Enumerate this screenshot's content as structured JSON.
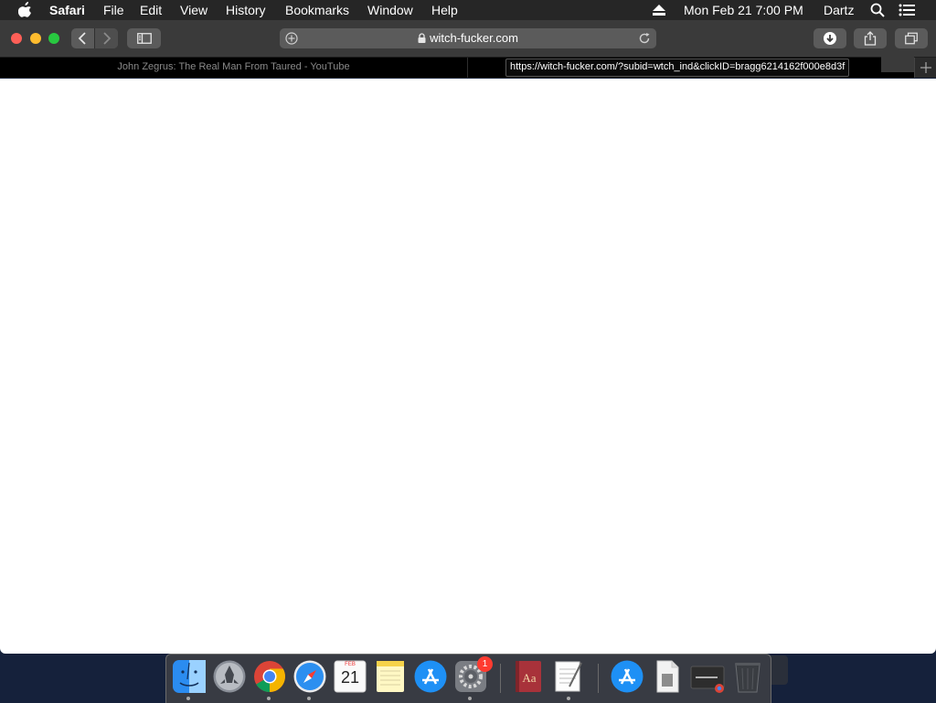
{
  "menubar": {
    "app_name": "Safari",
    "items": [
      "File",
      "Edit",
      "View",
      "History",
      "Bookmarks",
      "Window",
      "Help"
    ],
    "clock": "Mon Feb 21  7:00 PM",
    "user": "Dartz"
  },
  "toolbar": {
    "address_domain": "witch-fucker.com"
  },
  "tabs": [
    {
      "title": "John Zegrus: The Real Man From Taured - YouTube"
    },
    {
      "title": ""
    }
  ],
  "status_url": "https://witch-fucker.com/?subid=wtch_ind&clickID=bragg6214162f000e8d3f",
  "dock": {
    "apps": [
      "finder",
      "launchpad",
      "chrome",
      "safari",
      "calendar",
      "notes",
      "app-store",
      "system-preferences",
      "dictionary",
      "textedit",
      "app-store-downloads",
      "document",
      "chrome-window",
      "trash"
    ],
    "calendar_month": "FEB",
    "calendar_day": "21",
    "sys_prefs_badge": "1"
  },
  "colors": {
    "menubar_bg": "#262626",
    "toolbar_bg": "#3a3a3a",
    "tabbar_bg": "#000000",
    "content_bg": "#ffffff",
    "desktop_bg": "#15213b"
  }
}
